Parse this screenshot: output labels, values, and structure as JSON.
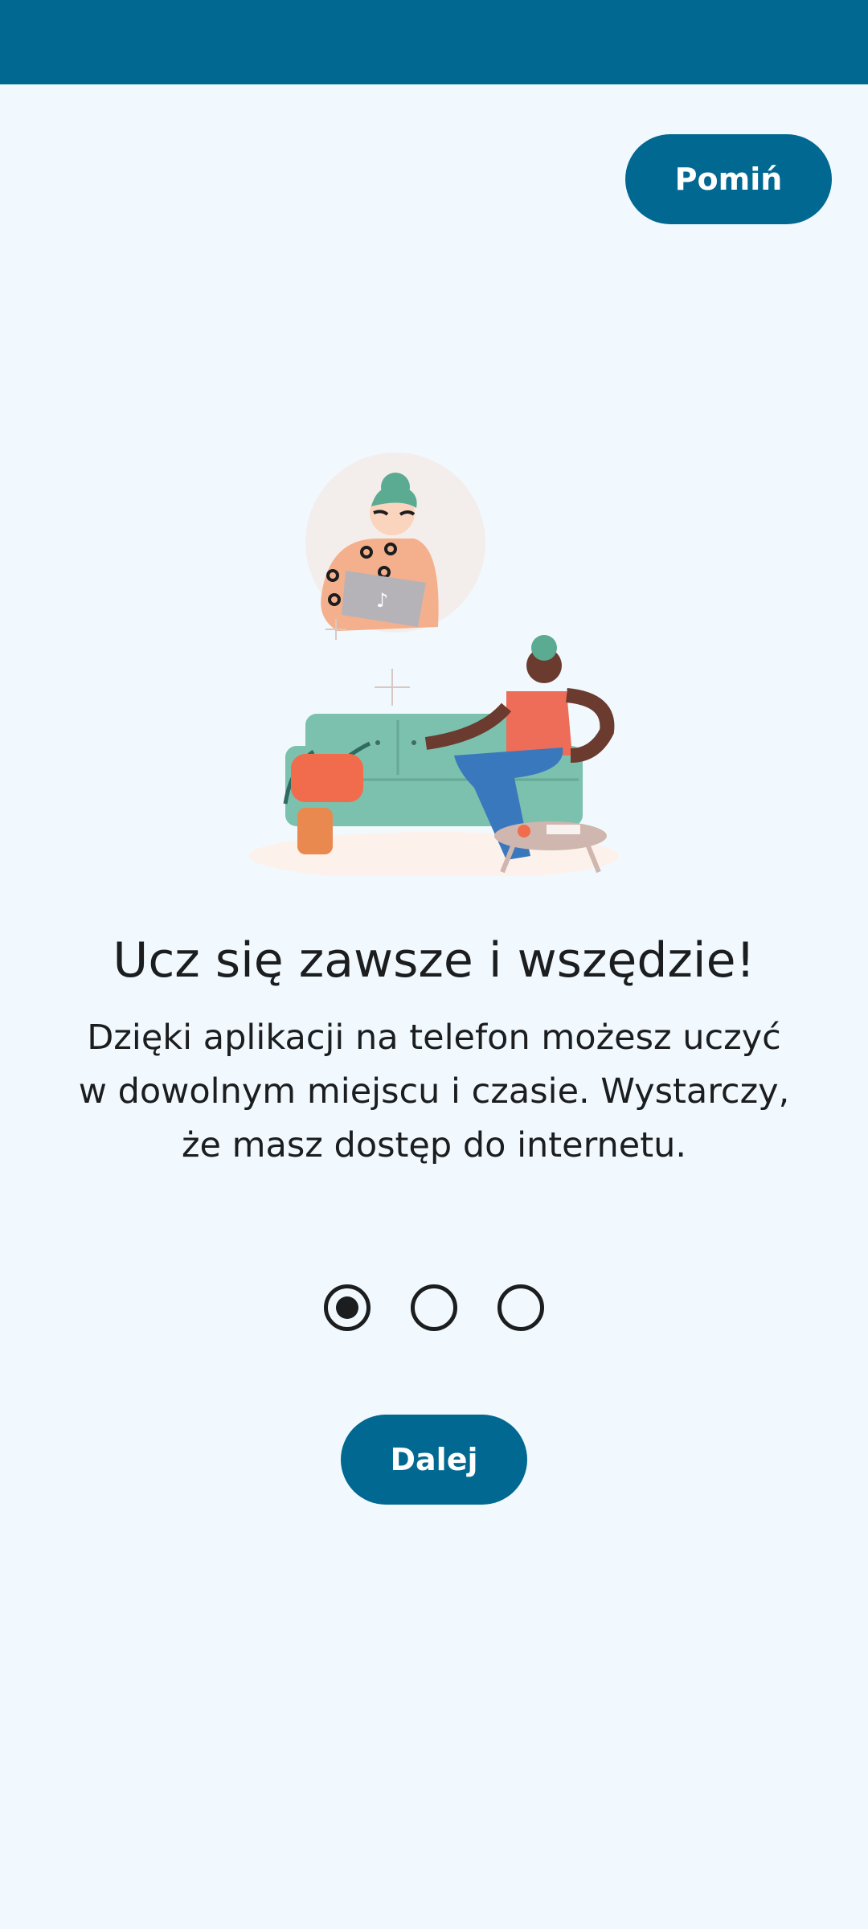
{
  "header": {
    "bar_color": "#016891"
  },
  "skip_button": {
    "label": "Pomiń"
  },
  "onboarding": {
    "title": "Ucz się zawsze i wszędzie!",
    "description": "Dzięki aplikacji na telefon możesz uczyć w dowolnym miejscu i czasie. Wystarczy, że masz dostęp do internetu.",
    "illustration_icon": "person-on-sofa-video-call-illustration",
    "current_page": 1,
    "total_pages": 3
  },
  "next_button": {
    "label": "Dalej"
  },
  "colors": {
    "accent": "#016891",
    "background": "#f1f9fe",
    "text": "#1b1d1f"
  }
}
